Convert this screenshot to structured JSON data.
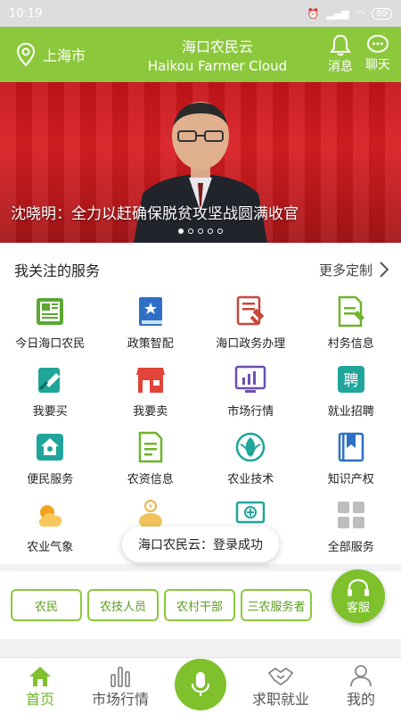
{
  "status": {
    "time": "10:19",
    "battery": "89"
  },
  "header": {
    "location": "上海市",
    "title_cn": "海口农民云",
    "title_en": "Haikou Farmer Cloud",
    "messages_label": "消息",
    "chat_label": "聊天"
  },
  "banner": {
    "caption": "沈晓明：全力以赶确保脱贫攻坚战圆满收官",
    "slide_count": 5,
    "active_slide": 1
  },
  "services": {
    "title": "我关注的服务",
    "more_label": "更多定制",
    "items": [
      {
        "label": "今日海口农民",
        "icon": "newspaper-icon"
      },
      {
        "label": "政策智配",
        "icon": "policy-book-icon"
      },
      {
        "label": "海口政务办理",
        "icon": "gov-affairs-icon"
      },
      {
        "label": "村务信息",
        "icon": "village-doc-icon"
      },
      {
        "label": "我要买",
        "icon": "buy-card-icon"
      },
      {
        "label": "我要卖",
        "icon": "store-icon"
      },
      {
        "label": "市场行情",
        "icon": "market-chart-icon"
      },
      {
        "label": "就业招聘",
        "icon": "recruit-icon"
      },
      {
        "label": "便民服务",
        "icon": "home-service-icon"
      },
      {
        "label": "农资信息",
        "icon": "farm-supply-icon"
      },
      {
        "label": "农业技术",
        "icon": "agri-tech-icon"
      },
      {
        "label": "知识产权",
        "icon": "ip-bookmark-icon"
      },
      {
        "label": "农业气象",
        "icon": "weather-icon"
      },
      {
        "label": "",
        "icon": "piggy-bank-icon"
      },
      {
        "label": "",
        "icon": "monitor-plus-icon"
      },
      {
        "label": "全部服务",
        "icon": "all-services-icon"
      }
    ]
  },
  "toast": "海口农民云：登录成功",
  "roles": [
    "农民",
    "农技人员",
    "农村干部",
    "三农服务者"
  ],
  "fab_label": "客服",
  "tabbar": {
    "home": "首页",
    "market": "市场行情",
    "jobs": "求职就业",
    "mine": "我的"
  }
}
